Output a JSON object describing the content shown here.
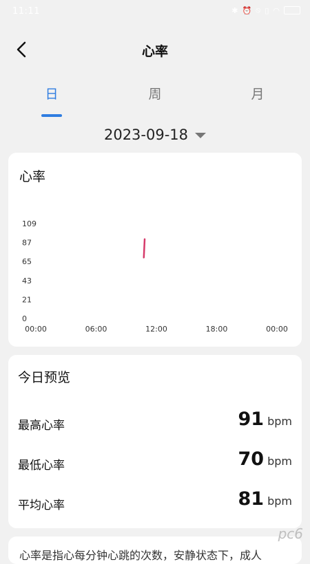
{
  "status_bar": {
    "time": "11:11",
    "icons": [
      "bluetooth-icon",
      "alarm-icon",
      "mute-icon",
      "sim-icon",
      "wifi-icon",
      "battery-icon"
    ]
  },
  "header": {
    "back_icon": "chevron-left-icon",
    "title": "心率"
  },
  "tabs": [
    {
      "label": "日",
      "active": true
    },
    {
      "label": "周",
      "active": false
    },
    {
      "label": "月",
      "active": false
    }
  ],
  "date": "2023-09-18",
  "chart_card": {
    "title": "心率"
  },
  "chart_data": {
    "type": "line",
    "x_ticks": [
      "00:00",
      "06:00",
      "12:00",
      "18:00",
      "00:00"
    ],
    "y_ticks": [
      "109",
      "87",
      "65",
      "43",
      "21",
      "0"
    ],
    "ylim": [
      0,
      109
    ],
    "series": [
      {
        "x": [
          "10:45",
          "10:50"
        ],
        "y": [
          70,
          91
        ]
      }
    ],
    "colors": {
      "line": "#d63a6a"
    }
  },
  "summary": {
    "title": "今日预览",
    "unit": "bpm",
    "items": [
      {
        "label": "最高心率",
        "value": "91"
      },
      {
        "label": "最低心率",
        "value": "70"
      },
      {
        "label": "平均心率",
        "value": "81"
      }
    ]
  },
  "bottom_card": {
    "text": "心率是指心每分钟心跳的次数，安静状态下，成人"
  },
  "watermark": "pc6"
}
